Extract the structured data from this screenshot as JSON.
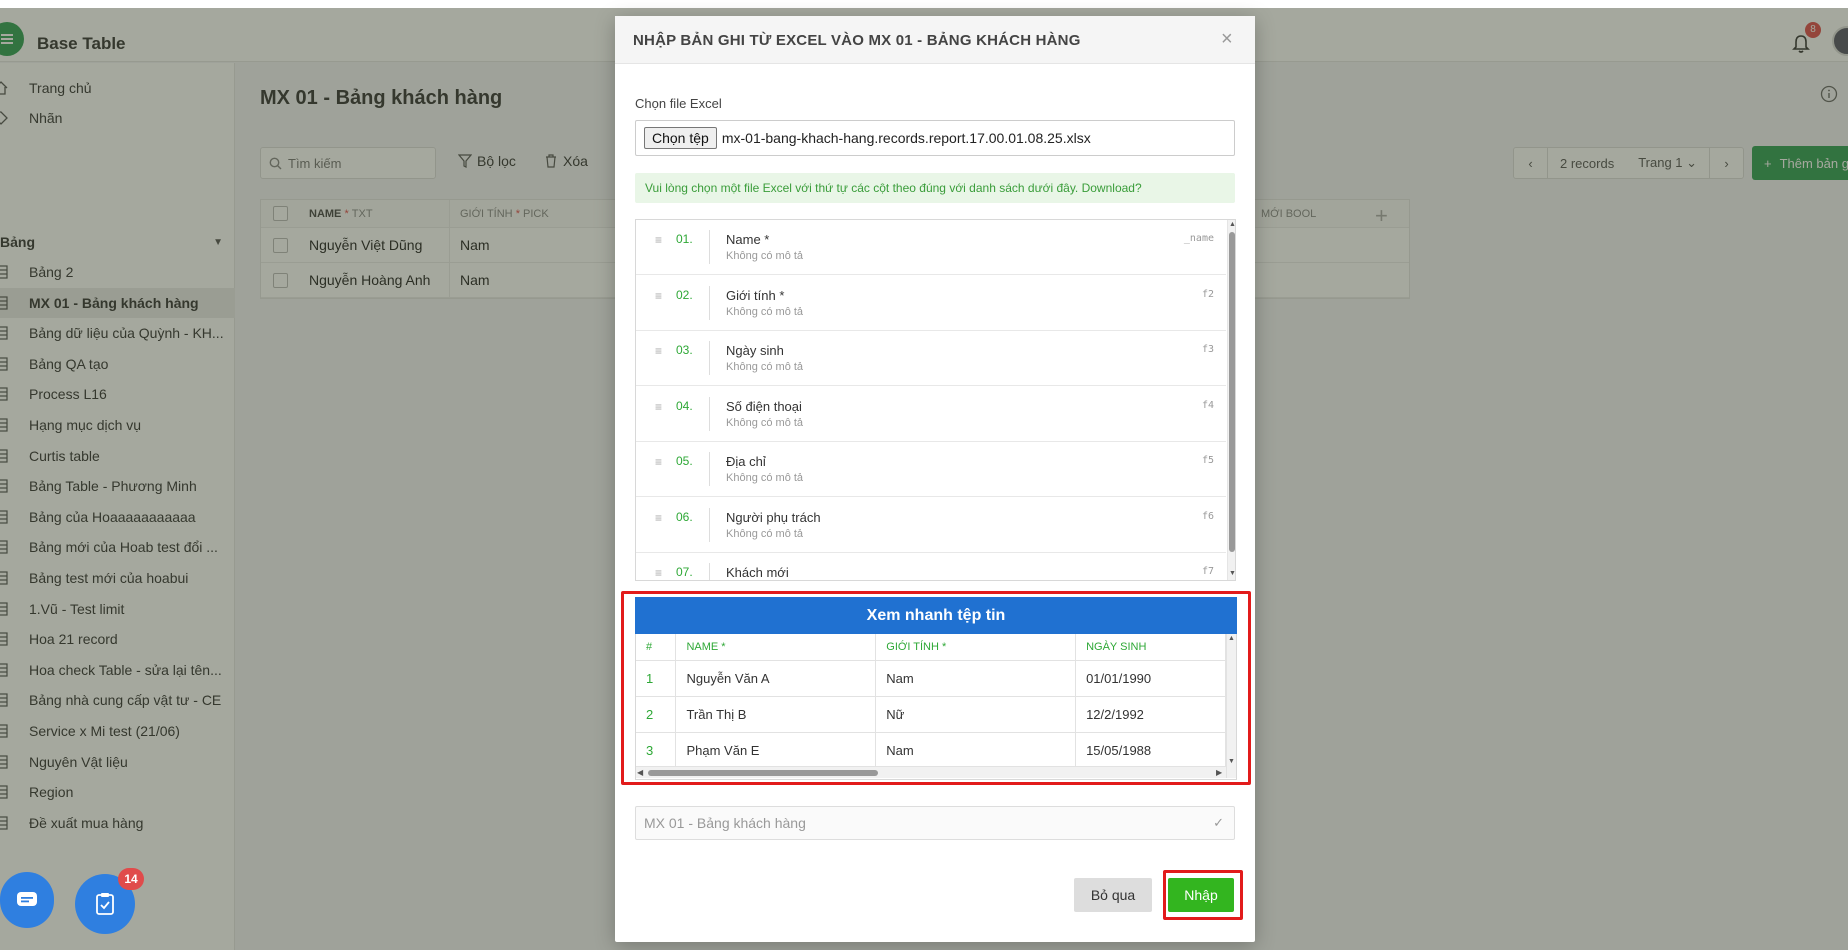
{
  "app": {
    "title": "Base Table",
    "notification_count": "8"
  },
  "sidebar": {
    "home": "Trang chủ",
    "labels": "Nhãn",
    "section": "Bảng",
    "items": [
      "Bảng 2",
      "MX 01 - Bảng khách hàng",
      "Bảng dữ liệu của Quỳnh - KH...",
      "Bảng QA tạo",
      "Process L16",
      "Hạng mục dịch vụ",
      "Curtis table",
      "Bảng Table - Phương Minh",
      "Bảng của Hoaaaaaaaaaaa",
      "Bảng mới của Hoab test đổi ...",
      "Bảng test mới của hoabui",
      "1.Vũ - Test limit",
      "Hoa 21 record",
      "Hoa check Table - sửa lại tên...",
      "Bảng nhà cung cấp vật tư - CE",
      "Service x Mi test (21/06)",
      "Nguyên Vật liệu",
      "Region",
      "Đề xuất mua hàng"
    ],
    "active_index": 1
  },
  "main": {
    "title": "MX 01 - Bảng khách hàng",
    "search_placeholder": "Tìm kiếm",
    "filter_label": "Bộ lọc",
    "delete_label": "Xóa",
    "records": "2 records",
    "page": "Trang 1",
    "add_button": "Thêm bản ghi",
    "grid": {
      "headers": [
        {
          "name": "NAME",
          "req": "*",
          "type": "TXT"
        },
        {
          "name": "GIỚI TÍNH",
          "req": "*",
          "type": "PICK"
        }
      ],
      "right_header": "MỚI BOOL",
      "rows": [
        [
          "Nguyễn Việt Dũng",
          "Nam"
        ],
        [
          "Nguyễn Hoàng Anh",
          "Nam"
        ]
      ]
    }
  },
  "fab": {
    "task_badge": "14"
  },
  "modal": {
    "title": "NHẬP BẢN GHI TỪ EXCEL VÀO MX 01 - BẢNG KHÁCH HÀNG",
    "file_label": "Chọn file Excel",
    "choose_file_button": "Chọn tệp",
    "file_name": "mx-01-bang-khach-hang.records.report.17.00.01.08.25.xlsx",
    "note": "Vui lòng chọn một file Excel với thứ tự các cột theo đúng với danh sách dưới đây. Download?",
    "fields": [
      {
        "num": "01.",
        "name": "Name *",
        "desc": "Không có mô tả",
        "key": "_name"
      },
      {
        "num": "02.",
        "name": "Giới tính *",
        "desc": "Không có mô tả",
        "key": "f2"
      },
      {
        "num": "03.",
        "name": "Ngày sinh",
        "desc": "Không có mô tả",
        "key": "f3"
      },
      {
        "num": "04.",
        "name": "Số điện thoại",
        "desc": "Không có mô tả",
        "key": "f4"
      },
      {
        "num": "05.",
        "name": "Địa chỉ",
        "desc": "Không có mô tả",
        "key": "f5"
      },
      {
        "num": "06.",
        "name": "Người phụ trách",
        "desc": "Không có mô tả",
        "key": "f6"
      },
      {
        "num": "07.",
        "name": "Khách mới",
        "desc": "",
        "key": "f7"
      }
    ],
    "preview": {
      "title": "Xem nhanh tệp tin",
      "columns": [
        "#",
        "NAME *",
        "GIỚI TÍNH *",
        "NGÀY SINH"
      ],
      "rows": [
        [
          "1",
          "Nguyễn Văn A",
          "Nam",
          "01/01/1990"
        ],
        [
          "2",
          "Trần Thị B",
          "Nữ",
          "12/2/1992"
        ],
        [
          "3",
          "Phạm Văn E",
          "Nam",
          "15/05/1988"
        ]
      ]
    },
    "target_table": "MX 01 - Bảng khách hàng",
    "cancel_button": "Bỏ qua",
    "import_button": "Nhập"
  }
}
